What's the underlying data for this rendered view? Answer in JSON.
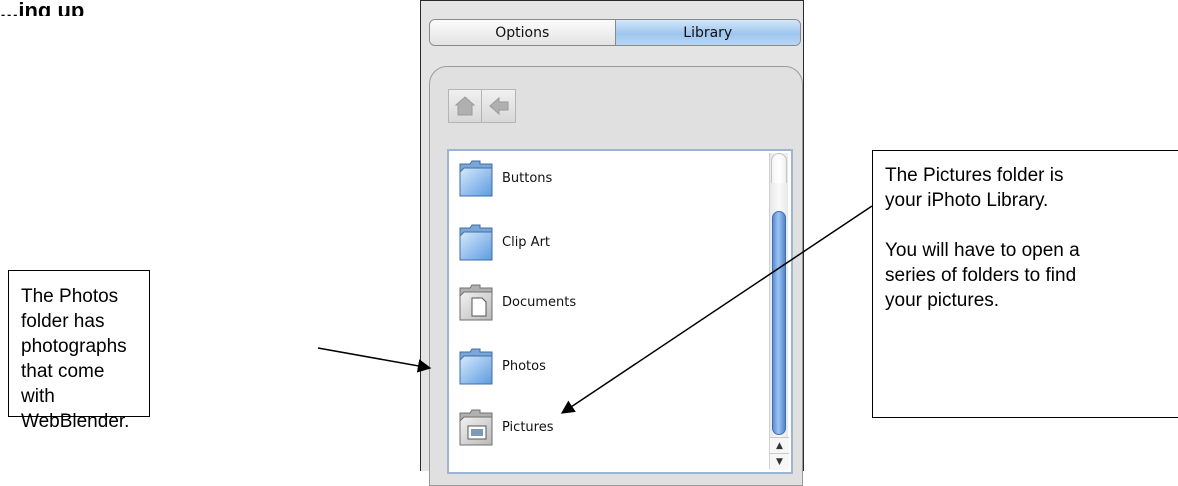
{
  "heading": "...ing up",
  "tabs": [
    {
      "label": "Options",
      "active": false
    },
    {
      "label": "Library",
      "active": true
    }
  ],
  "toolbar": {
    "home_icon": "house-icon",
    "back_icon": "back-arrow-icon"
  },
  "library_items": [
    {
      "label": "Buttons",
      "icon": "folder-icon"
    },
    {
      "label": "Clip Art",
      "icon": "folder-icon"
    },
    {
      "label": "Documents",
      "icon": "documents-folder-icon"
    },
    {
      "label": "Photos",
      "icon": "folder-icon"
    },
    {
      "label": "Pictures",
      "icon": "pictures-folder-icon"
    }
  ],
  "callouts": {
    "photos": {
      "line1": "The Photos folder has",
      "line2": "photographs that come",
      "line3": "with WebBlender."
    },
    "pictures": {
      "line1": "The Pictures folder is",
      "line2": "your iPhoto Library.",
      "line3": "You will have to open a",
      "line4": "series of folders to find",
      "line5": "your pictures."
    }
  },
  "colors": {
    "accent": "#9ec6ef",
    "scroll_thumb": "#5a8fd6"
  }
}
